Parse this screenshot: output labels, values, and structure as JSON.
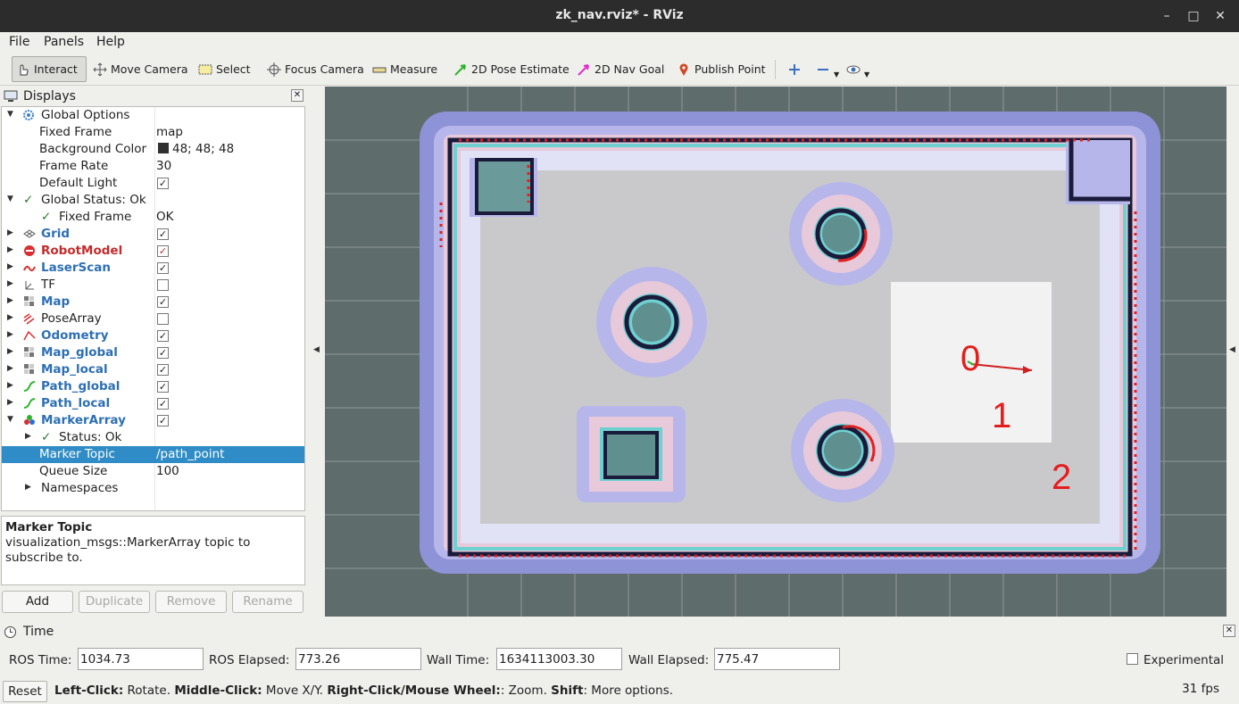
{
  "window": {
    "title": "zk_nav.rviz* - RViz"
  },
  "menubar": {
    "file": "File",
    "panels": "Panels",
    "help": "Help"
  },
  "toolbar": {
    "interact": "Interact",
    "move_camera": "Move Camera",
    "select": "Select",
    "focus_camera": "Focus Camera",
    "measure": "Measure",
    "pose_estimate": "2D Pose Estimate",
    "nav_goal": "2D Nav Goal",
    "publish_point": "Publish Point"
  },
  "displays": {
    "title": "Displays",
    "global_options": "Global Options",
    "fixed_frame_label": "Fixed Frame",
    "fixed_frame_value": "map",
    "bg_color_label": "Background Color",
    "bg_color_value": "48; 48; 48",
    "frame_rate_label": "Frame Rate",
    "frame_rate_value": "30",
    "default_light_label": "Default Light",
    "global_status": "Global Status: Ok",
    "gs_fixed_frame": "Fixed Frame",
    "gs_fixed_frame_value": "OK",
    "items": [
      {
        "label": "Grid",
        "checked": true,
        "style": "blue"
      },
      {
        "label": "RobotModel",
        "checked": true,
        "style": "red"
      },
      {
        "label": "LaserScan",
        "checked": true,
        "style": "blue"
      },
      {
        "label": "TF",
        "checked": false,
        "style": "plain"
      },
      {
        "label": "Map",
        "checked": true,
        "style": "blue"
      },
      {
        "label": "PoseArray",
        "checked": false,
        "style": "plain"
      },
      {
        "label": "Odometry",
        "checked": true,
        "style": "blue"
      },
      {
        "label": "Map_global",
        "checked": true,
        "style": "blue"
      },
      {
        "label": "Map_local",
        "checked": true,
        "style": "blue"
      },
      {
        "label": "Path_global",
        "checked": true,
        "style": "blue"
      },
      {
        "label": "Path_local",
        "checked": true,
        "style": "blue"
      },
      {
        "label": "MarkerArray",
        "checked": true,
        "style": "blue"
      }
    ],
    "ma_status": "Status: Ok",
    "marker_topic_label": "Marker Topic",
    "marker_topic_value": "/path_point",
    "queue_size_label": "Queue Size",
    "queue_size_value": "100",
    "namespaces_label": "Namespaces"
  },
  "description": {
    "heading": "Marker Topic",
    "text": "visualization_msgs::MarkerArray topic to subscribe to."
  },
  "panel_buttons": {
    "add": "Add",
    "duplicate": "Duplicate",
    "remove": "Remove",
    "rename": "Rename"
  },
  "viewport": {
    "markers": [
      "0",
      "1",
      "2"
    ]
  },
  "time": {
    "title": "Time",
    "ros_time_label": "ROS Time:",
    "ros_time": "1034.73",
    "ros_elapsed_label": "ROS Elapsed:",
    "ros_elapsed": "773.26",
    "wall_time_label": "Wall Time:",
    "wall_time": "1634113003.30",
    "wall_elapsed_label": "Wall Elapsed:",
    "wall_elapsed": "775.47",
    "experimental_label": "Experimental"
  },
  "status": {
    "reset": "Reset",
    "lc": "Left-Click:",
    "lc_t": " Rotate. ",
    "mc": "Middle-Click:",
    "mc_t": " Move X/Y. ",
    "rc": "Right-Click/Mouse Wheel:",
    "rc_t": ": Zoom. ",
    "sh": "Shift",
    "sh_t": ": More options.",
    "fps": "31 fps"
  },
  "colors": {
    "accent": "#308cc6",
    "link_blue": "#2d6fb4",
    "error_red": "#c42b2b",
    "bg_swatch": "#303030"
  }
}
